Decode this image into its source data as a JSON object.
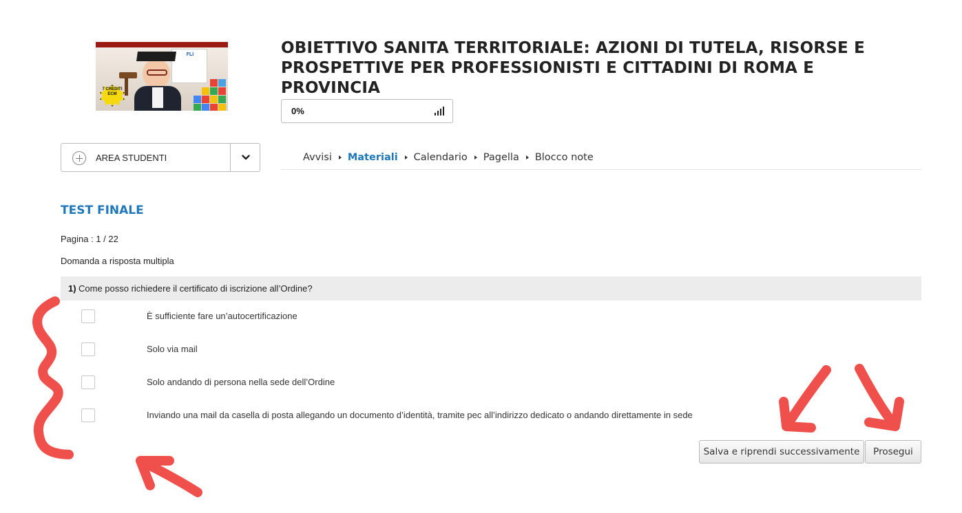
{
  "course": {
    "image_alt": "course-cover",
    "image_poster_text": "FLI",
    "image_badge_text": "7 CREDITI ECM",
    "title": "OBIETTIVO SANITA TERRITORIALE: AZIONI DI TUTELA, RISORSE E PROSPETTIVE PER PROFESSIONISTI E CITTADINI DI ROMA E PROVINCIA",
    "progress_label": "0%",
    "progress_fraction": 0
  },
  "area": {
    "label": "AREA STUDENTI"
  },
  "nav": {
    "items": [
      {
        "label": "Avvisi",
        "active": false
      },
      {
        "label": "Materiali",
        "active": true
      },
      {
        "label": "Calendario",
        "active": false
      },
      {
        "label": "Pagella",
        "active": false
      },
      {
        "label": "Blocco note",
        "active": false
      }
    ]
  },
  "test": {
    "title": "TEST FINALE",
    "page": "Pagina : 1 / 22",
    "question_type": "Domanda a risposta multipla",
    "question_number": "1)",
    "question_text": "Come posso richiedere il certificato di iscrizione all’Ordine?",
    "options": [
      "È sufficiente fare un’autocertificazione",
      "Solo via mail",
      "Solo andando di persona nella sede dell’Ordine",
      "Inviando una mail da casella di posta allegando un documento d’identità, tramite pec all’indirizzo dedicato o andando direttamente in sede"
    ]
  },
  "buttons": {
    "save": "Salva e riprendi successivamente",
    "next": "Prosegui"
  },
  "colors": {
    "accent": "#1f77b9",
    "annotation": "#f0504b",
    "question_bar": "#ececec"
  }
}
